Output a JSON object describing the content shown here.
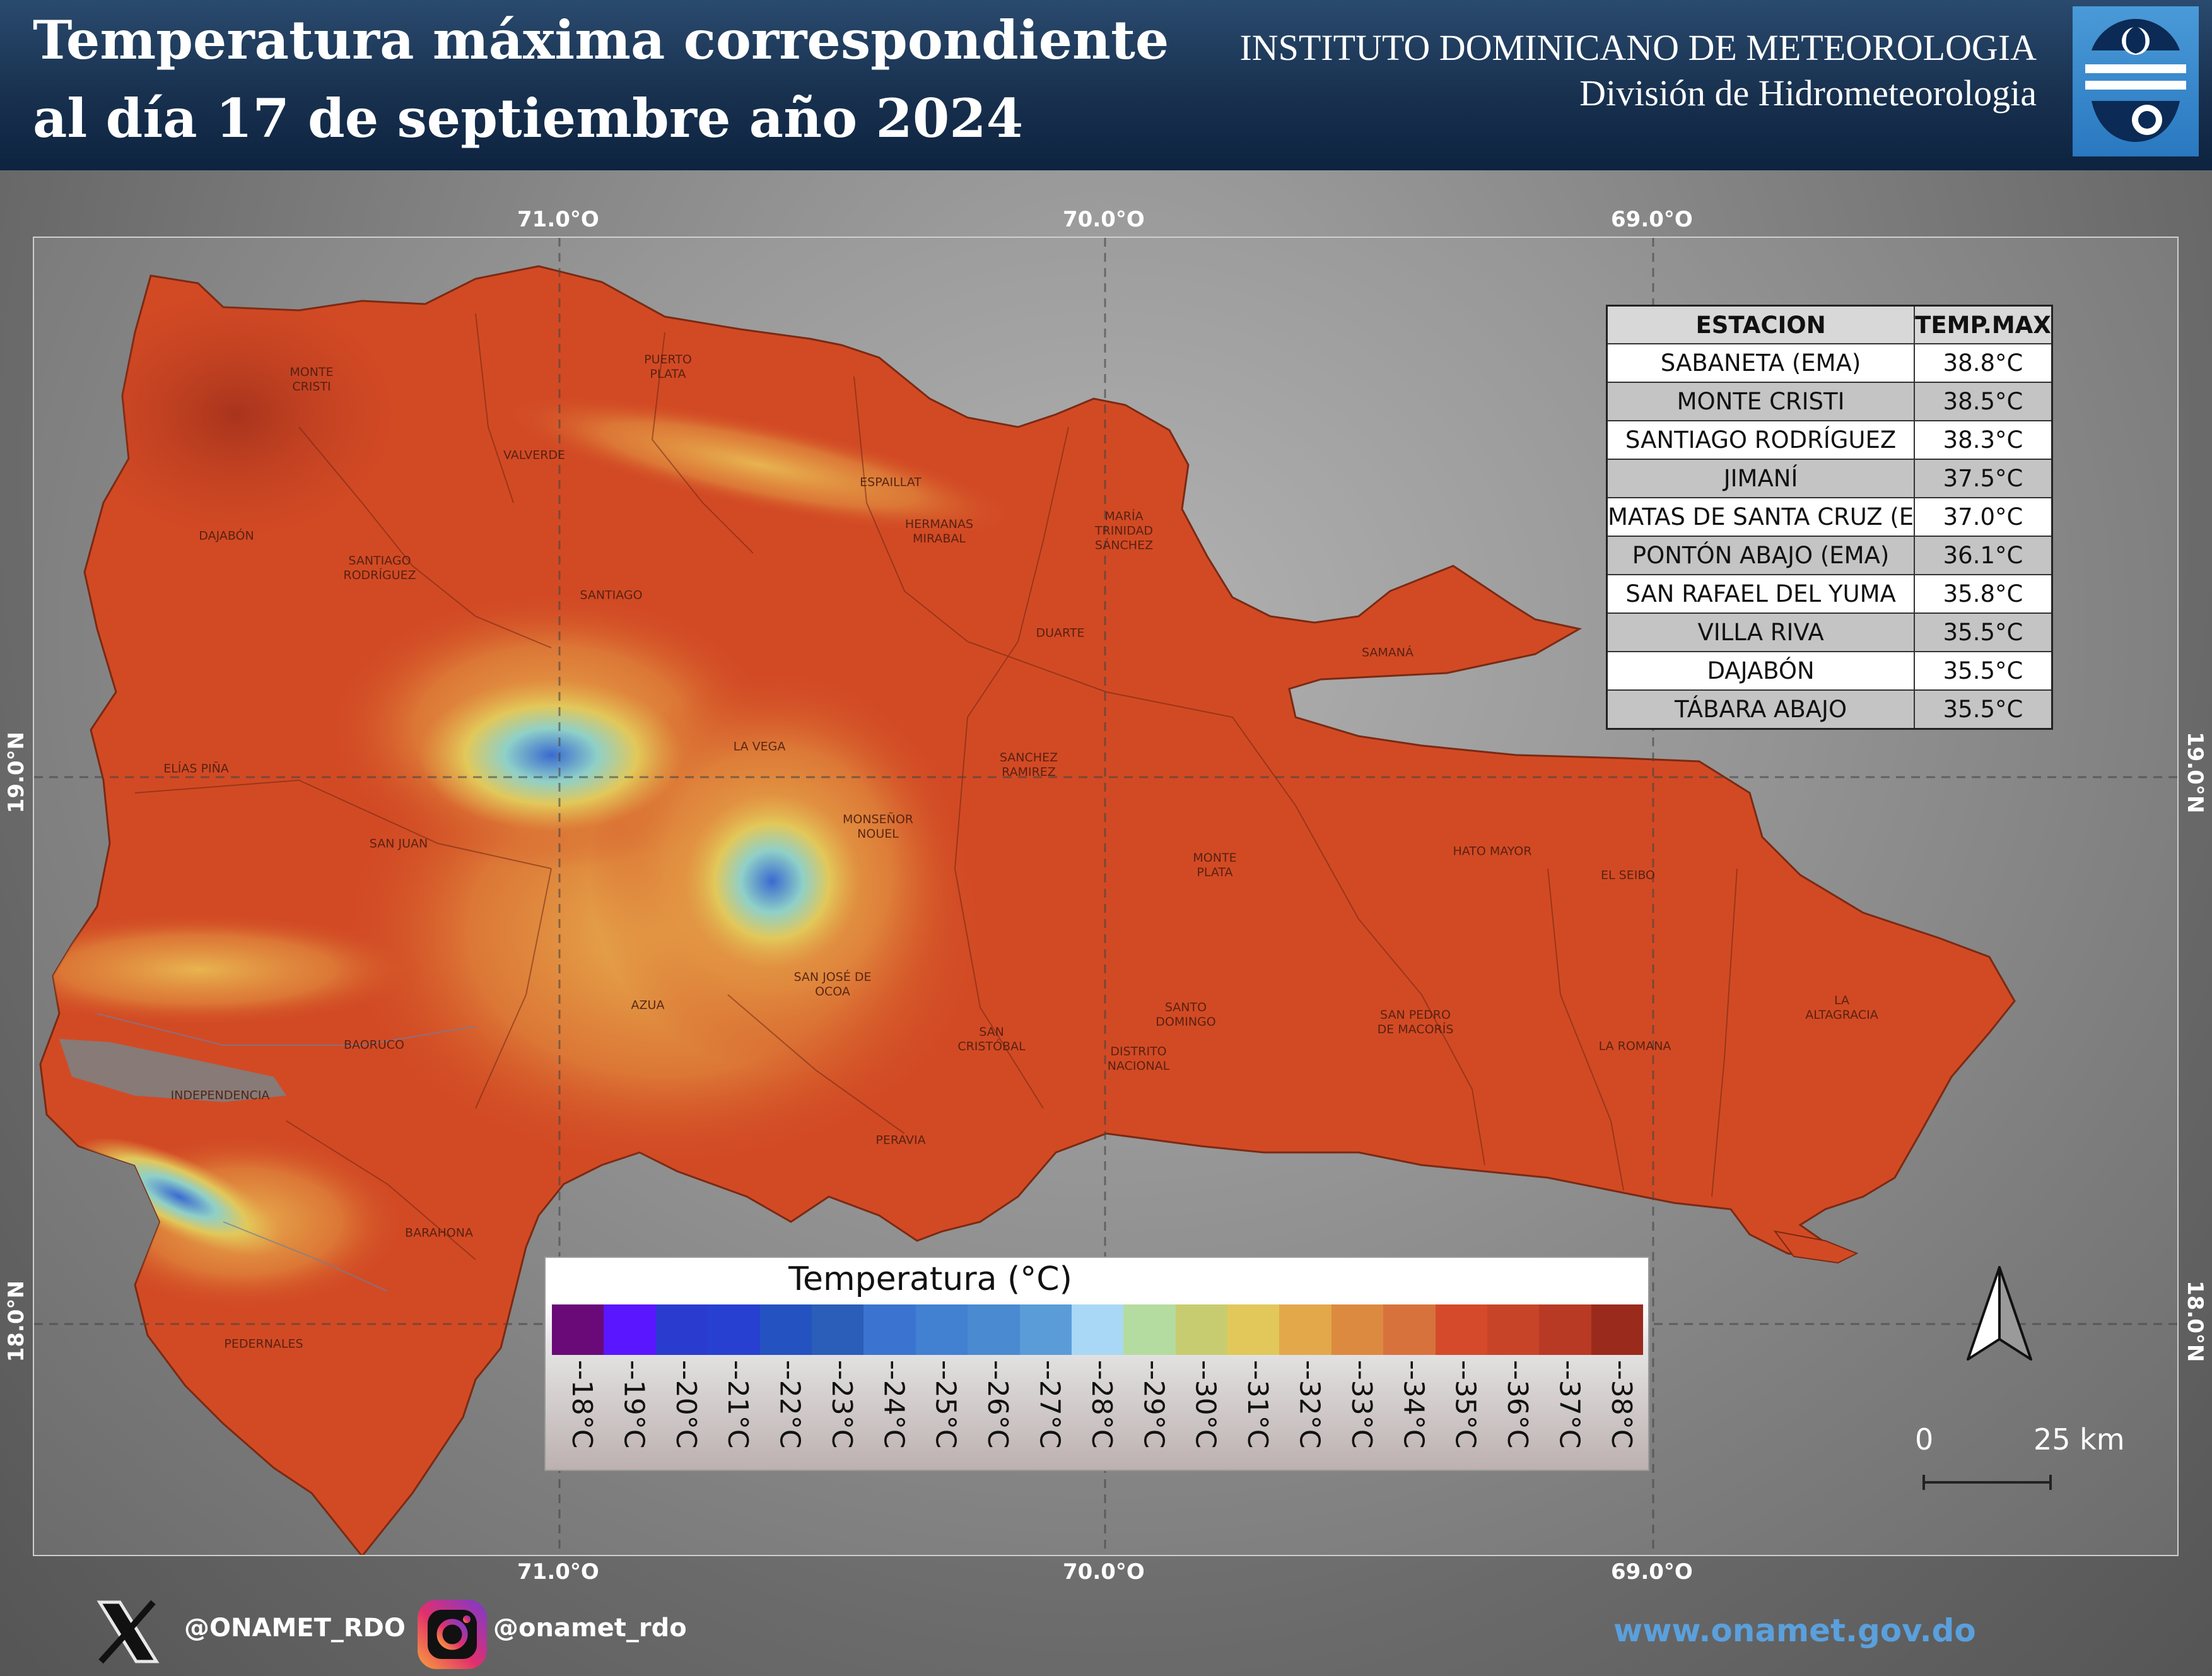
{
  "header": {
    "title_line1": "Temperatura máxima correspondiente",
    "title_line2": "al día 17 de septiembre año 2024",
    "institute": "INSTITUTO DOMINICANO DE METEOROLOGIA",
    "division": "División de Hidrometeorologia"
  },
  "coordinates": {
    "longitudes": [
      "71.0°O",
      "70.0°O",
      "69.0°O"
    ],
    "latitudes": [
      "19.0°N",
      "18.0°N"
    ]
  },
  "provinces": [
    "MONTE\nCRISTI",
    "PUERTO\nPLATA",
    "VALVERDE",
    "ESPAILLAT",
    "HERMANAS\nMIRABAL",
    "MARÍA\nTRINIDAD\nSÁNCHEZ",
    "DAJABÓN",
    "SANTIAGO\nRODRÍGUEZ",
    "SANTIAGO",
    "DUARTE",
    "SAMANÁ",
    "LA VEGA",
    "SANCHEZ\nRAMIREZ",
    "ELÍAS PIÑA",
    "MONSEÑOR\nNOUEL",
    "SAN JUAN",
    "MONTE\nPLATA",
    "HATO MAYOR",
    "EL SEIBO",
    "SAN JOSÉ DE\nOCOA",
    "AZUA",
    "SANTO\nDOMINGO",
    "SAN PEDRO\nDE MACORÍS",
    "LA\nALTAGRACIA",
    "BAORUCO",
    "SAN\nCRISTÓBAL",
    "DISTRITO\nNACIONAL",
    "LA ROMANA",
    "INDEPENDENCIA",
    "PERAVIA",
    "BARAHONA",
    "PEDERNALES"
  ],
  "station_table": {
    "headers": [
      "ESTACION",
      "TEMP.MAX"
    ],
    "rows": [
      {
        "station": "SABANETA (EMA)",
        "temp": "38.8°C"
      },
      {
        "station": "MONTE CRISTI",
        "temp": "38.5°C"
      },
      {
        "station": "SANTIAGO RODRÍGUEZ",
        "temp": "38.3°C"
      },
      {
        "station": "JIMANÍ",
        "temp": "37.5°C"
      },
      {
        "station": "MATAS DE SANTA CRUZ (E",
        "temp": "37.0°C"
      },
      {
        "station": "PONTÓN ABAJO (EMA)",
        "temp": "36.1°C"
      },
      {
        "station": "SAN RAFAEL DEL YUMA",
        "temp": "35.8°C"
      },
      {
        "station": "VILLA RIVA",
        "temp": "35.5°C"
      },
      {
        "station": "DAJABÓN",
        "temp": "35.5°C"
      },
      {
        "station": "TÁBARA ABAJO",
        "temp": "35.5°C"
      }
    ]
  },
  "legend": {
    "title": "Temperatura (°C)",
    "items": [
      {
        "label": "--18°C",
        "color": "#6a0a78"
      },
      {
        "label": "--19°C",
        "color": "#5a16ff"
      },
      {
        "label": "--20°C",
        "color": "#2a3ccf"
      },
      {
        "label": "--21°C",
        "color": "#2840d2"
      },
      {
        "label": "--22°C",
        "color": "#2452c0"
      },
      {
        "label": "--23°C",
        "color": "#2a5eb8"
      },
      {
        "label": "--24°C",
        "color": "#3a74d0"
      },
      {
        "label": "--25°C",
        "color": "#4280d2"
      },
      {
        "label": "--26°C",
        "color": "#4a8ad0"
      },
      {
        "label": "--27°C",
        "color": "#5a9cd8"
      },
      {
        "label": "--28°C",
        "color": "#a8d8f5"
      },
      {
        "label": "--29°C",
        "color": "#b4dca0"
      },
      {
        "label": "--30°C",
        "color": "#c8cc70"
      },
      {
        "label": "--31°C",
        "color": "#e2c85a"
      },
      {
        "label": "--32°C",
        "color": "#e2a84a"
      },
      {
        "label": "--33°C",
        "color": "#dc8a40"
      },
      {
        "label": "--34°C",
        "color": "#d8723c"
      },
      {
        "label": "--35°C",
        "color": "#d44a2a"
      },
      {
        "label": "--36°C",
        "color": "#c84428"
      },
      {
        "label": "--37°C",
        "color": "#b83a24"
      },
      {
        "label": "--38°C",
        "color": "#9a2a1c"
      }
    ]
  },
  "scale_bar": {
    "zero": "0",
    "distance": "25 km"
  },
  "footer": {
    "twitter": "@ONAMET_RDO",
    "instagram": "@onamet_rdo",
    "website": "www.onamet.gov.do"
  },
  "colors": {
    "land": "#d24a24",
    "land_hot": "#b83a1e",
    "highland_warm": "#e2b04a",
    "highland_cool": "#8fd0c8",
    "highland_cold": "#3a6ad0",
    "header_bg": "#18314f",
    "url": "#5aa0dd"
  }
}
